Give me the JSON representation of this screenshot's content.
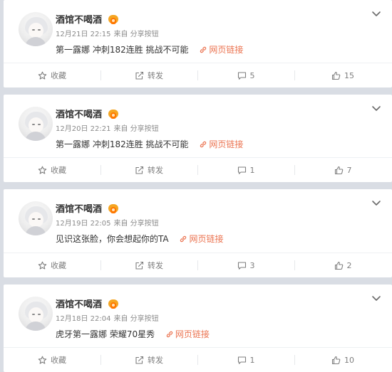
{
  "posts": [
    {
      "user": "酒馆不喝酒",
      "time": "12月21日 22:15",
      "source": "来自 分享按钮",
      "text": "第一露娜 冲刺182连胜 挑战不可能",
      "link": "网页链接",
      "actions": {
        "favorite": "收藏",
        "repost": "转发",
        "comments": "5",
        "likes": "15"
      }
    },
    {
      "user": "酒馆不喝酒",
      "time": "12月20日 22:21",
      "source": "来自 分享按钮",
      "text": "第一露娜 冲刺182连胜 挑战不可能",
      "link": "网页链接",
      "actions": {
        "favorite": "收藏",
        "repost": "转发",
        "comments": "1",
        "likes": "7"
      }
    },
    {
      "user": "酒馆不喝酒",
      "time": "12月19日 22:05",
      "source": "来自 分享按钮",
      "text": "见识这张脸，你会想起你的TA",
      "link": "网页链接",
      "actions": {
        "favorite": "收藏",
        "repost": "转发",
        "comments": "3",
        "likes": "2"
      }
    },
    {
      "user": "酒馆不喝酒",
      "time": "12月18日 22:04",
      "source": "来自 分享按钮",
      "text": "虎牙第一露娜 荣耀70星秀",
      "link": "网页链接",
      "actions": {
        "favorite": "收藏",
        "repost": "转发",
        "comments": "1",
        "likes": "10"
      }
    }
  ],
  "icons": {
    "avatar": "avatar-illustration",
    "badge": "vip-badge-icon",
    "link": "link-icon",
    "favorite": "star-icon",
    "repost": "repost-icon",
    "comment": "comment-icon",
    "like": "thumbs-up-icon",
    "more": "chevron-down-icon"
  },
  "colors": {
    "background": "#d9dde4",
    "card": "#ffffff",
    "link": "#eb7350",
    "meta_text": "#8a8a8a",
    "badge": "#ff7700"
  }
}
